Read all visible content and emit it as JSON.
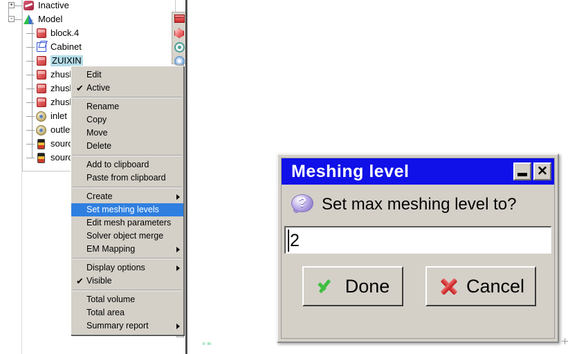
{
  "tree": {
    "items": [
      {
        "label": "Inactive",
        "icon": "inactive-icon",
        "indent": 0,
        "expander": "+",
        "selected": false
      },
      {
        "label": "Model",
        "icon": "model-icon",
        "indent": 0,
        "expander": "-",
        "selected": false
      },
      {
        "label": "block.4",
        "icon": "red-cube-icon",
        "indent": 1,
        "expander": "",
        "selected": false
      },
      {
        "label": "Cabinet",
        "icon": "blue-cube-icon",
        "indent": 1,
        "expander": "",
        "selected": false
      },
      {
        "label": "ZUIXIN",
        "icon": "red-cube-icon",
        "indent": 1,
        "expander": "",
        "selected": true
      },
      {
        "label": "zhushu",
        "icon": "red-cube-icon",
        "indent": 1,
        "expander": "",
        "selected": false
      },
      {
        "label": "zhushu",
        "icon": "red-cube-icon",
        "indent": 1,
        "expander": "",
        "selected": false
      },
      {
        "label": "zhushu",
        "icon": "red-cube-icon",
        "indent": 1,
        "expander": "",
        "selected": false
      },
      {
        "label": "inlet",
        "icon": "fan-icon",
        "indent": 1,
        "expander": "",
        "selected": false
      },
      {
        "label": "outlet",
        "icon": "fan-icon",
        "indent": 1,
        "expander": "",
        "selected": false
      },
      {
        "label": "source",
        "icon": "source-icon",
        "indent": 1,
        "expander": "",
        "selected": false
      },
      {
        "label": "source",
        "icon": "source-icon",
        "indent": 1,
        "expander": "",
        "selected": false
      }
    ]
  },
  "toolbar": {
    "buttons": [
      {
        "name": "enclosure-icon",
        "title": "Enclosure"
      },
      {
        "name": "block-cube-icon",
        "title": "Block"
      },
      {
        "name": "fan-icon",
        "title": "Fan"
      },
      {
        "name": "gear-icon",
        "title": "Settings"
      }
    ]
  },
  "context_menu": {
    "groups": [
      {
        "items": [
          {
            "label": "Edit",
            "check": false,
            "submenu": false,
            "highlight": false
          },
          {
            "label": "Active",
            "check": true,
            "submenu": false,
            "highlight": false
          }
        ]
      },
      {
        "items": [
          {
            "label": "Rename",
            "check": false,
            "submenu": false,
            "highlight": false
          },
          {
            "label": "Copy",
            "check": false,
            "submenu": false,
            "highlight": false
          },
          {
            "label": "Move",
            "check": false,
            "submenu": false,
            "highlight": false
          },
          {
            "label": "Delete",
            "check": false,
            "submenu": false,
            "highlight": false
          }
        ]
      },
      {
        "items": [
          {
            "label": "Add to clipboard",
            "check": false,
            "submenu": false,
            "highlight": false
          },
          {
            "label": "Paste from clipboard",
            "check": false,
            "submenu": false,
            "highlight": false
          }
        ]
      },
      {
        "items": [
          {
            "label": "Create",
            "check": false,
            "submenu": true,
            "highlight": false
          },
          {
            "label": "Set meshing levels",
            "check": false,
            "submenu": false,
            "highlight": true
          },
          {
            "label": "Edit mesh parameters",
            "check": false,
            "submenu": false,
            "highlight": false
          },
          {
            "label": "Solver object merge",
            "check": false,
            "submenu": false,
            "highlight": false
          },
          {
            "label": "EM Mapping",
            "check": false,
            "submenu": true,
            "highlight": false
          }
        ]
      },
      {
        "items": [
          {
            "label": "Display options",
            "check": false,
            "submenu": true,
            "highlight": false
          },
          {
            "label": "Visible",
            "check": true,
            "submenu": false,
            "highlight": false
          }
        ]
      },
      {
        "items": [
          {
            "label": "Total volume",
            "check": false,
            "submenu": false,
            "highlight": false
          },
          {
            "label": "Total area",
            "check": false,
            "submenu": false,
            "highlight": false
          },
          {
            "label": "Summary report",
            "check": false,
            "submenu": true,
            "highlight": false
          }
        ]
      }
    ],
    "checkmark_glyph": "✔",
    "highlight_color": "#2f7fe0"
  },
  "dialog": {
    "title": "Meshing level",
    "titlebar_color": "#1010e8",
    "minimize_label": "_",
    "close_label": "✕",
    "question_glyph": "?",
    "prompt": "Set max meshing level to?",
    "input_value": "2",
    "input_placeholder": "",
    "done_label": "Done",
    "cancel_label": "Cancel"
  }
}
